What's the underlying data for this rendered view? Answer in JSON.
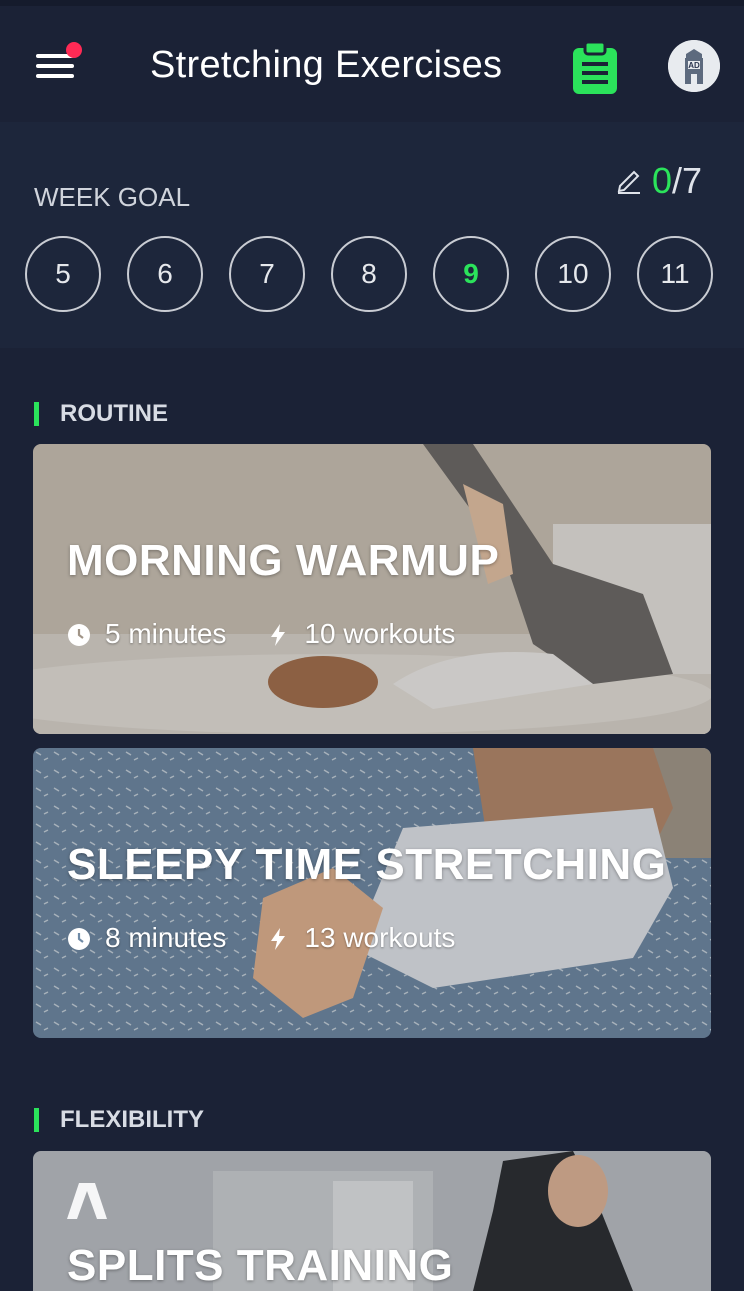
{
  "app": {
    "title": "Stretching Exercises",
    "accent_color": "#2be35b",
    "notification_color": "#ff2a55",
    "icons": {
      "menu": "hamburger-menu-icon",
      "plan": "clipboard-icon",
      "remove_ads": "ad-lighthouse-icon"
    },
    "ad_badge": "AD"
  },
  "week_goal": {
    "label": "WEEK GOAL",
    "done": "0",
    "total": "/7",
    "days": [
      "5",
      "6",
      "7",
      "8",
      "9",
      "10",
      "11"
    ],
    "today": "9"
  },
  "sections": [
    {
      "title": "ROUTINE",
      "cards": [
        {
          "title": "MORNING WARMUP",
          "duration": "5 minutes",
          "workouts": "10 workouts"
        },
        {
          "title": "SLEEPY TIME STRETCHING",
          "duration": "8 minutes",
          "workouts": "13 workouts"
        }
      ]
    },
    {
      "title": "FLEXIBILITY",
      "cards": [
        {
          "title": "SPLITS TRAINING"
        }
      ]
    }
  ]
}
